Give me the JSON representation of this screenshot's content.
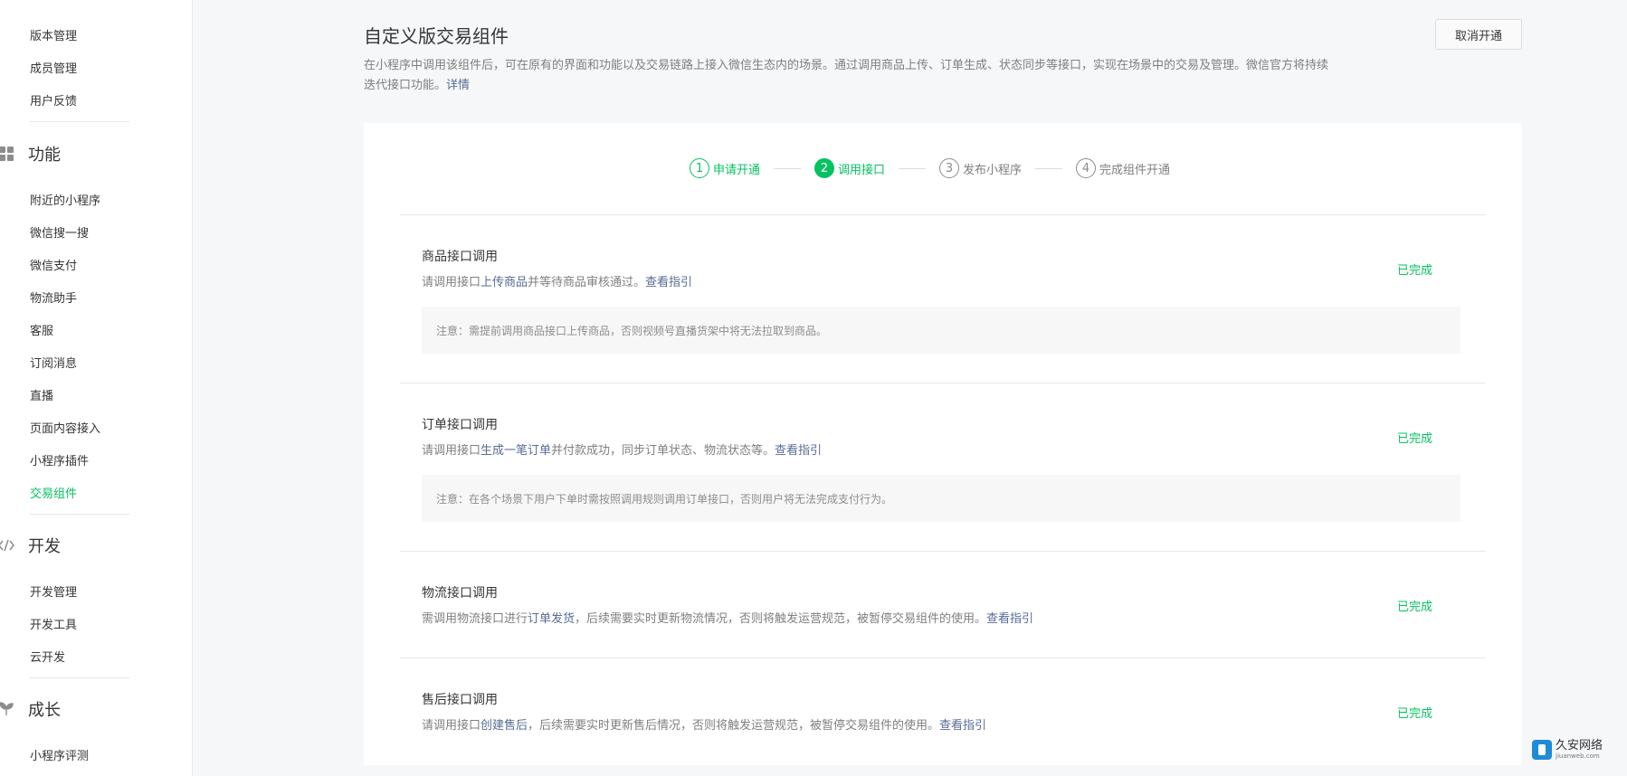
{
  "sidebar": {
    "items_top": [
      {
        "label": "版本管理"
      },
      {
        "label": "成员管理"
      },
      {
        "label": "用户反馈"
      }
    ],
    "group_features": {
      "label": "功能",
      "icon": "grid-icon"
    },
    "items_features": [
      {
        "label": "附近的小程序"
      },
      {
        "label": "微信搜一搜"
      },
      {
        "label": "微信支付"
      },
      {
        "label": "物流助手"
      },
      {
        "label": "客服"
      },
      {
        "label": "订阅消息"
      },
      {
        "label": "直播"
      },
      {
        "label": "页面内容接入"
      },
      {
        "label": "小程序插件"
      },
      {
        "label": "交易组件"
      }
    ],
    "active_item": "交易组件",
    "group_dev": {
      "label": "开发",
      "icon": "code-icon"
    },
    "items_dev": [
      {
        "label": "开发管理"
      },
      {
        "label": "开发工具"
      },
      {
        "label": "云开发"
      }
    ],
    "group_growth": {
      "label": "成长",
      "icon": "leaf-icon"
    },
    "items_growth": [
      {
        "label": "小程序评测"
      }
    ]
  },
  "header": {
    "title": "自定义版交易组件",
    "description": "在小程序中调用该组件后，可在原有的界面和功能以及交易链路上接入微信生态内的场景。通过调用商品上传、订单生成、状态同步等接口，实现在场景中的交易及管理。微信官方将持续迭代接口功能。",
    "details_link": "详情",
    "cancel_button": "取消开通"
  },
  "steps": [
    {
      "number": "1",
      "label": "申请开通",
      "state": "done"
    },
    {
      "number": "2",
      "label": "调用接口",
      "state": "current"
    },
    {
      "number": "3",
      "label": "发布小程序",
      "state": "todo"
    },
    {
      "number": "4",
      "label": "完成组件开通",
      "state": "todo"
    }
  ],
  "sections": [
    {
      "title": "商品接口调用",
      "desc_prefix": "请调用接口",
      "desc_link": "上传商品",
      "desc_suffix": "并等待商品审核通过。",
      "guide_link": "查看指引",
      "status": "已完成",
      "note": "注意：需提前调用商品接口上传商品，否则视频号直播货架中将无法拉取到商品。"
    },
    {
      "title": "订单接口调用",
      "desc_prefix": "请调用接口",
      "desc_link": "生成一笔订单",
      "desc_suffix": "并付款成功，同步订单状态、物流状态等。",
      "guide_link": "查看指引",
      "status": "已完成",
      "note": "注意：在各个场景下用户下单时需按照调用规则调用订单接口，否则用户将无法完成支付行为。"
    },
    {
      "title": "物流接口调用",
      "desc_prefix": "需调用物流接口进行",
      "desc_link": "订单发货",
      "desc_suffix": "，后续需要实时更新物流情况，否则将触发运营规范，被暂停交易组件的使用。",
      "guide_link": "查看指引",
      "status": "已完成"
    },
    {
      "title": "售后接口调用",
      "desc_prefix": "请调用接口",
      "desc_link": "创建售后",
      "desc_suffix": "，后续需要实时更新售后情况，否则将触发运营规范，被暂停交易组件的使用。",
      "guide_link": "查看指引",
      "status": "已完成"
    }
  ],
  "watermark": {
    "name": "久安网络",
    "domain": "jiuanweb.com"
  },
  "colors": {
    "accent": "#07c160",
    "link": "#576b95",
    "background": "#f6f7f9"
  }
}
